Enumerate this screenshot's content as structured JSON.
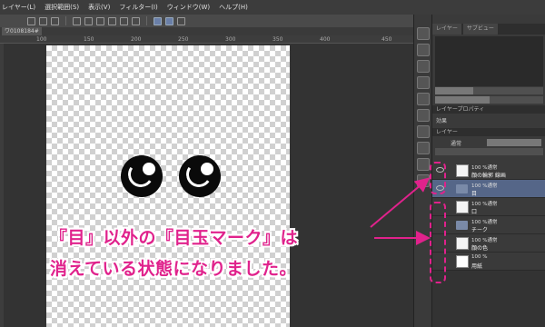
{
  "menu": [
    "レイヤー(L)",
    "選択範囲(S)",
    "表示(V)",
    "フィルター(I)",
    "ウィンドウ(W)",
    "ヘルプ(H)"
  ],
  "document": {
    "tab_label": "ワ0108184#"
  },
  "ruler": {
    "labels": [
      "100",
      "150",
      "200",
      "250",
      "300",
      "350",
      "400",
      "450"
    ]
  },
  "panel": {
    "tabs": [
      "レイヤー",
      "サブビュー"
    ],
    "property_title": "レイヤープロパティ",
    "effect_label": "効果",
    "layer_title": "レイヤー",
    "blend_mode": "通常"
  },
  "layers": [
    {
      "mode": "100 %通常",
      "name": "顔の輪郭 線画",
      "kind": "raster"
    },
    {
      "mode": "100 %通常",
      "name": "目",
      "kind": "folder",
      "selected": true
    },
    {
      "mode": "100 %通常",
      "name": "口",
      "kind": "raster"
    },
    {
      "mode": "100 %通常",
      "name": "チーク",
      "kind": "folder"
    },
    {
      "mode": "100 %通常",
      "name": "顔の色",
      "kind": "raster"
    },
    {
      "mode": "100 %",
      "name": "用紙",
      "kind": "paper"
    }
  ],
  "callout": {
    "line1": "『目』以外の『目玉マーク』は",
    "line2": "消えている状態になりました。"
  },
  "colors": {
    "accent": "#e0228c",
    "selected_layer": "#556688"
  }
}
